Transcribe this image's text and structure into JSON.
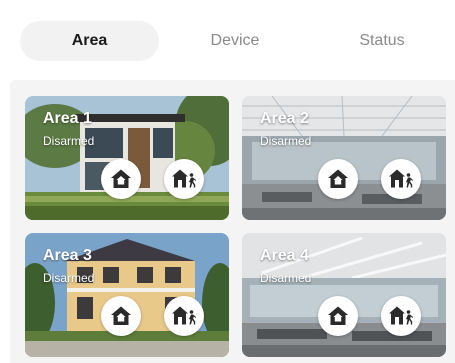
{
  "tabs": [
    {
      "label": "Area",
      "active": true
    },
    {
      "label": "Device",
      "active": false
    },
    {
      "label": "Status",
      "active": false
    }
  ],
  "areas": [
    {
      "name": "Area 1",
      "status": "Disarmed",
      "scene": "modern-house-exterior"
    },
    {
      "name": "Area 2",
      "status": "Disarmed",
      "scene": "office-interior"
    },
    {
      "name": "Area 3",
      "status": "Disarmed",
      "scene": "villa-exterior"
    },
    {
      "name": "Area 4",
      "status": "Disarmed",
      "scene": "office-interior"
    }
  ],
  "icons": {
    "home_arm": "home-arm-icon",
    "away_arm": "away-arm-icon"
  },
  "colors": {
    "active_tab_bg": "#f2f2f2",
    "active_tab_text": "#1c1c1c",
    "inactive_tab_text": "#8a8a8a",
    "content_bg": "#f4f4f4",
    "icon_color": "#2a2a2a"
  }
}
